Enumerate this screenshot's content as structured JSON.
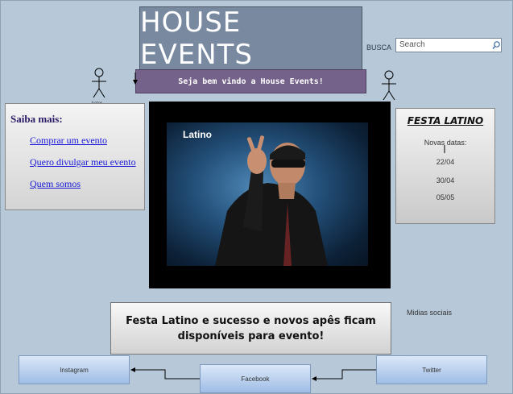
{
  "header": {
    "title": "HOUSE EVENTS",
    "welcome": "Seja bem vindo a House Events!",
    "busca_label": "BUSCA",
    "search_placeholder": "Search"
  },
  "actor_label": "Actor",
  "saiba_mais": {
    "heading": "Saiba mais:",
    "links": [
      "Comprar um evento",
      "Quero divulgar meu evento",
      "Quem somos"
    ]
  },
  "video": {
    "label": "Latino"
  },
  "festa": {
    "title": "FESTA LATINO",
    "subtitle": "Novas datas:",
    "dates": [
      "22/04",
      "30/04",
      "05/05"
    ]
  },
  "news": {
    "line1": "Festa Latino e sucesso e novos apês ficam",
    "line2": "disponíveis para evento!"
  },
  "social": {
    "heading": "Midias sociais",
    "instagram": "Instagram",
    "facebook": "Facebook",
    "twitter": "Twitter"
  }
}
